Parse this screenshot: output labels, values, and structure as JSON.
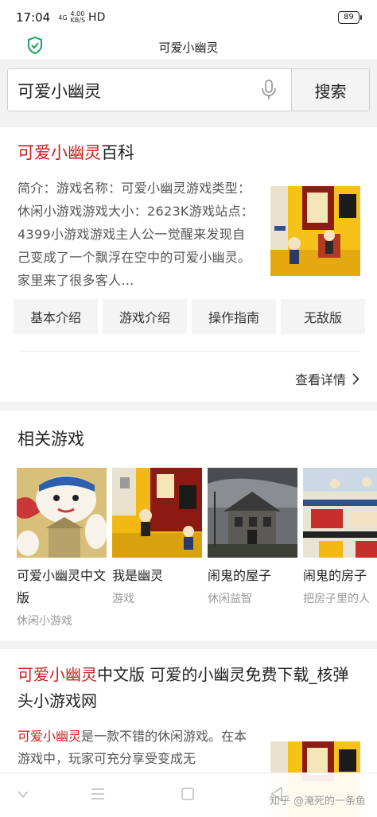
{
  "status_bar": {
    "time": "17:04",
    "signal": "4G",
    "speed_value": "4.00",
    "speed_unit": "KB/S",
    "network": "HD",
    "battery": "89"
  },
  "header": {
    "title": "可爱小幽灵"
  },
  "search": {
    "query": "可爱小幽灵",
    "button": "搜索"
  },
  "baike": {
    "title_highlight": "可爱小幽灵",
    "title_suffix": "百科",
    "description": "简介：游戏名称：可爱小幽灵游戏类型：休闲小游戏游戏大小：2623K游戏站点：4399小游戏游戏主人公一觉醒来发现自己变成了一个飘浮在空中的可爱小幽灵。家里来了很多客人…",
    "tags": [
      "基本介绍",
      "游戏介绍",
      "操作指南",
      "无敌版"
    ],
    "more_label": "查看详情"
  },
  "related": {
    "title": "相关游戏",
    "games": [
      {
        "name": "可爱小幽灵中文版",
        "category": "休闲小游戏"
      },
      {
        "name": "我是幽灵",
        "category": "游戏"
      },
      {
        "name": "闹鬼的屋子",
        "category": "休闲益智"
      },
      {
        "name": "闹鬼的房子",
        "category": "把房子里的人"
      }
    ]
  },
  "result": {
    "title_highlight": "可爱小幽灵",
    "title_rest": "中文版 可爱的小幽灵免费下载_核弹头小游戏网",
    "desc_highlight": "可爱小幽灵",
    "desc_rest": "是一款不错的休闲游戏。在本游戏中，玩家可充分享受变成无"
  },
  "watermark": "知乎 @淹死的一条鱼",
  "colors": {
    "highlight": "#c81e1e",
    "shield": "#1aa260"
  },
  "icons": [
    "shield-icon",
    "mic-icon",
    "chevron-right-icon",
    "nav-back-icon",
    "nav-menu-icon",
    "nav-home-icon",
    "nav-recent-icon"
  ]
}
